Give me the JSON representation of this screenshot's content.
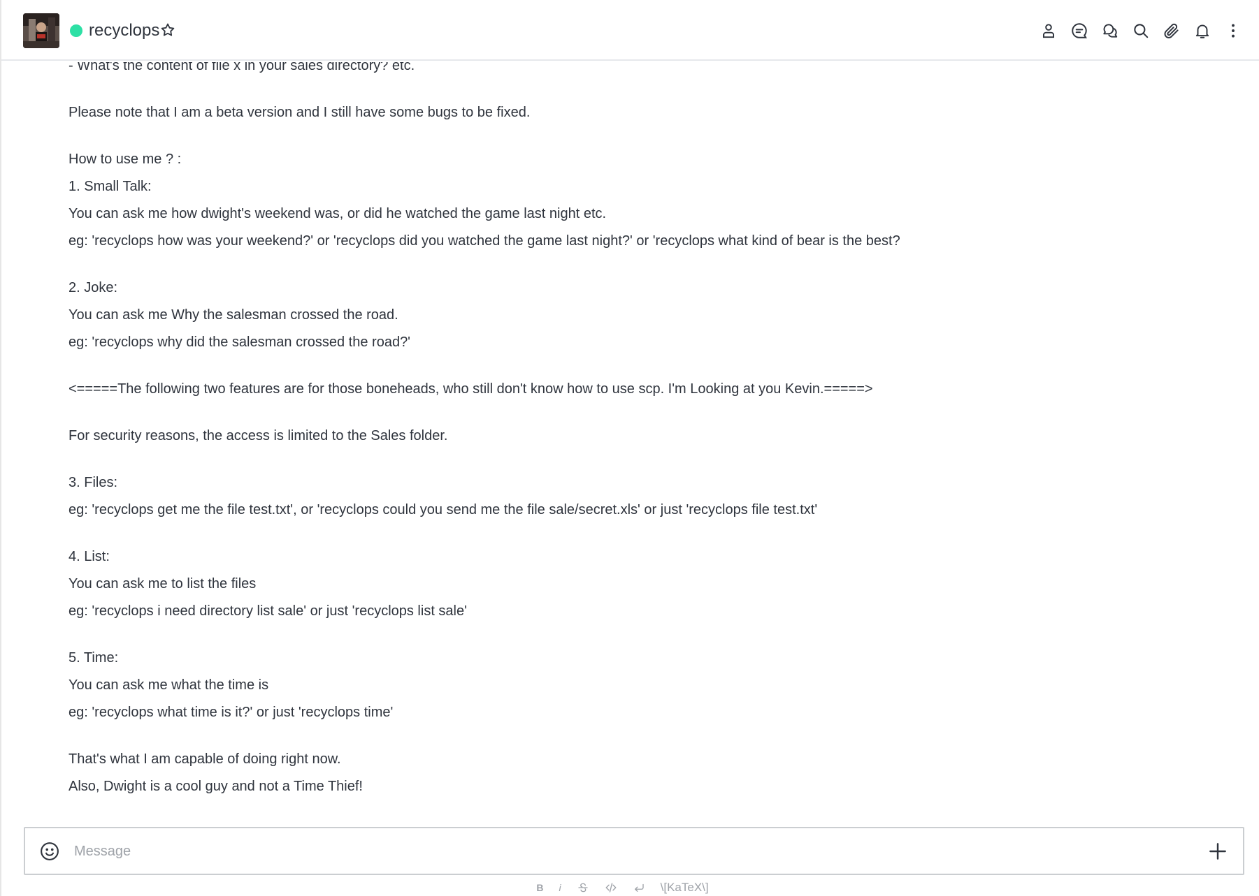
{
  "header": {
    "room_name": "recyclops",
    "status_color": "#2de0a5",
    "icons": [
      "user-info-icon",
      "discussion-icon",
      "threads-icon",
      "search-icon",
      "attachment-icon",
      "notification-bell-icon",
      "kebab-menu-icon"
    ]
  },
  "message": {
    "lines": [
      "- What's the content of file x in your sales directory? etc.",
      "",
      "Please note that I am a beta version and I still have some bugs to be fixed.",
      "",
      "How to use me ? :",
      "1. Small Talk:",
      "You can ask me how dwight's weekend was, or did he watched the game last night etc.",
      "eg: 'recyclops how was your weekend?' or 'recyclops did you watched the game last night?' or 'recyclops what kind of bear is the best?",
      "",
      "2. Joke:",
      "You can ask me Why the salesman crossed the road.",
      "eg: 'recyclops why did the salesman crossed the road?'",
      "",
      "<=====The following two features are for those boneheads, who still don't know how to use scp. I'm Looking at you Kevin.=====>",
      "",
      "For security reasons, the access is limited to the Sales folder.",
      "",
      "3. Files:",
      "eg: 'recyclops get me the file test.txt', or 'recyclops could you send me the file sale/secret.xls' or just 'recyclops file test.txt'",
      "",
      "4. List:",
      "You can ask me to list the files",
      "eg: 'recyclops i need directory list sale' or just 'recyclops list sale'",
      "",
      "5. Time:",
      "You can ask me what the time is",
      "eg: 'recyclops what time is it?' or just 'recyclops time'",
      "",
      "That's what I am capable of doing right now.",
      "Also, Dwight is a cool guy and not a Time Thief!"
    ]
  },
  "composer": {
    "placeholder": "Message",
    "formatting": {
      "bold": "B",
      "italic": "i",
      "katex": "\\[KaTeX\\]"
    }
  }
}
